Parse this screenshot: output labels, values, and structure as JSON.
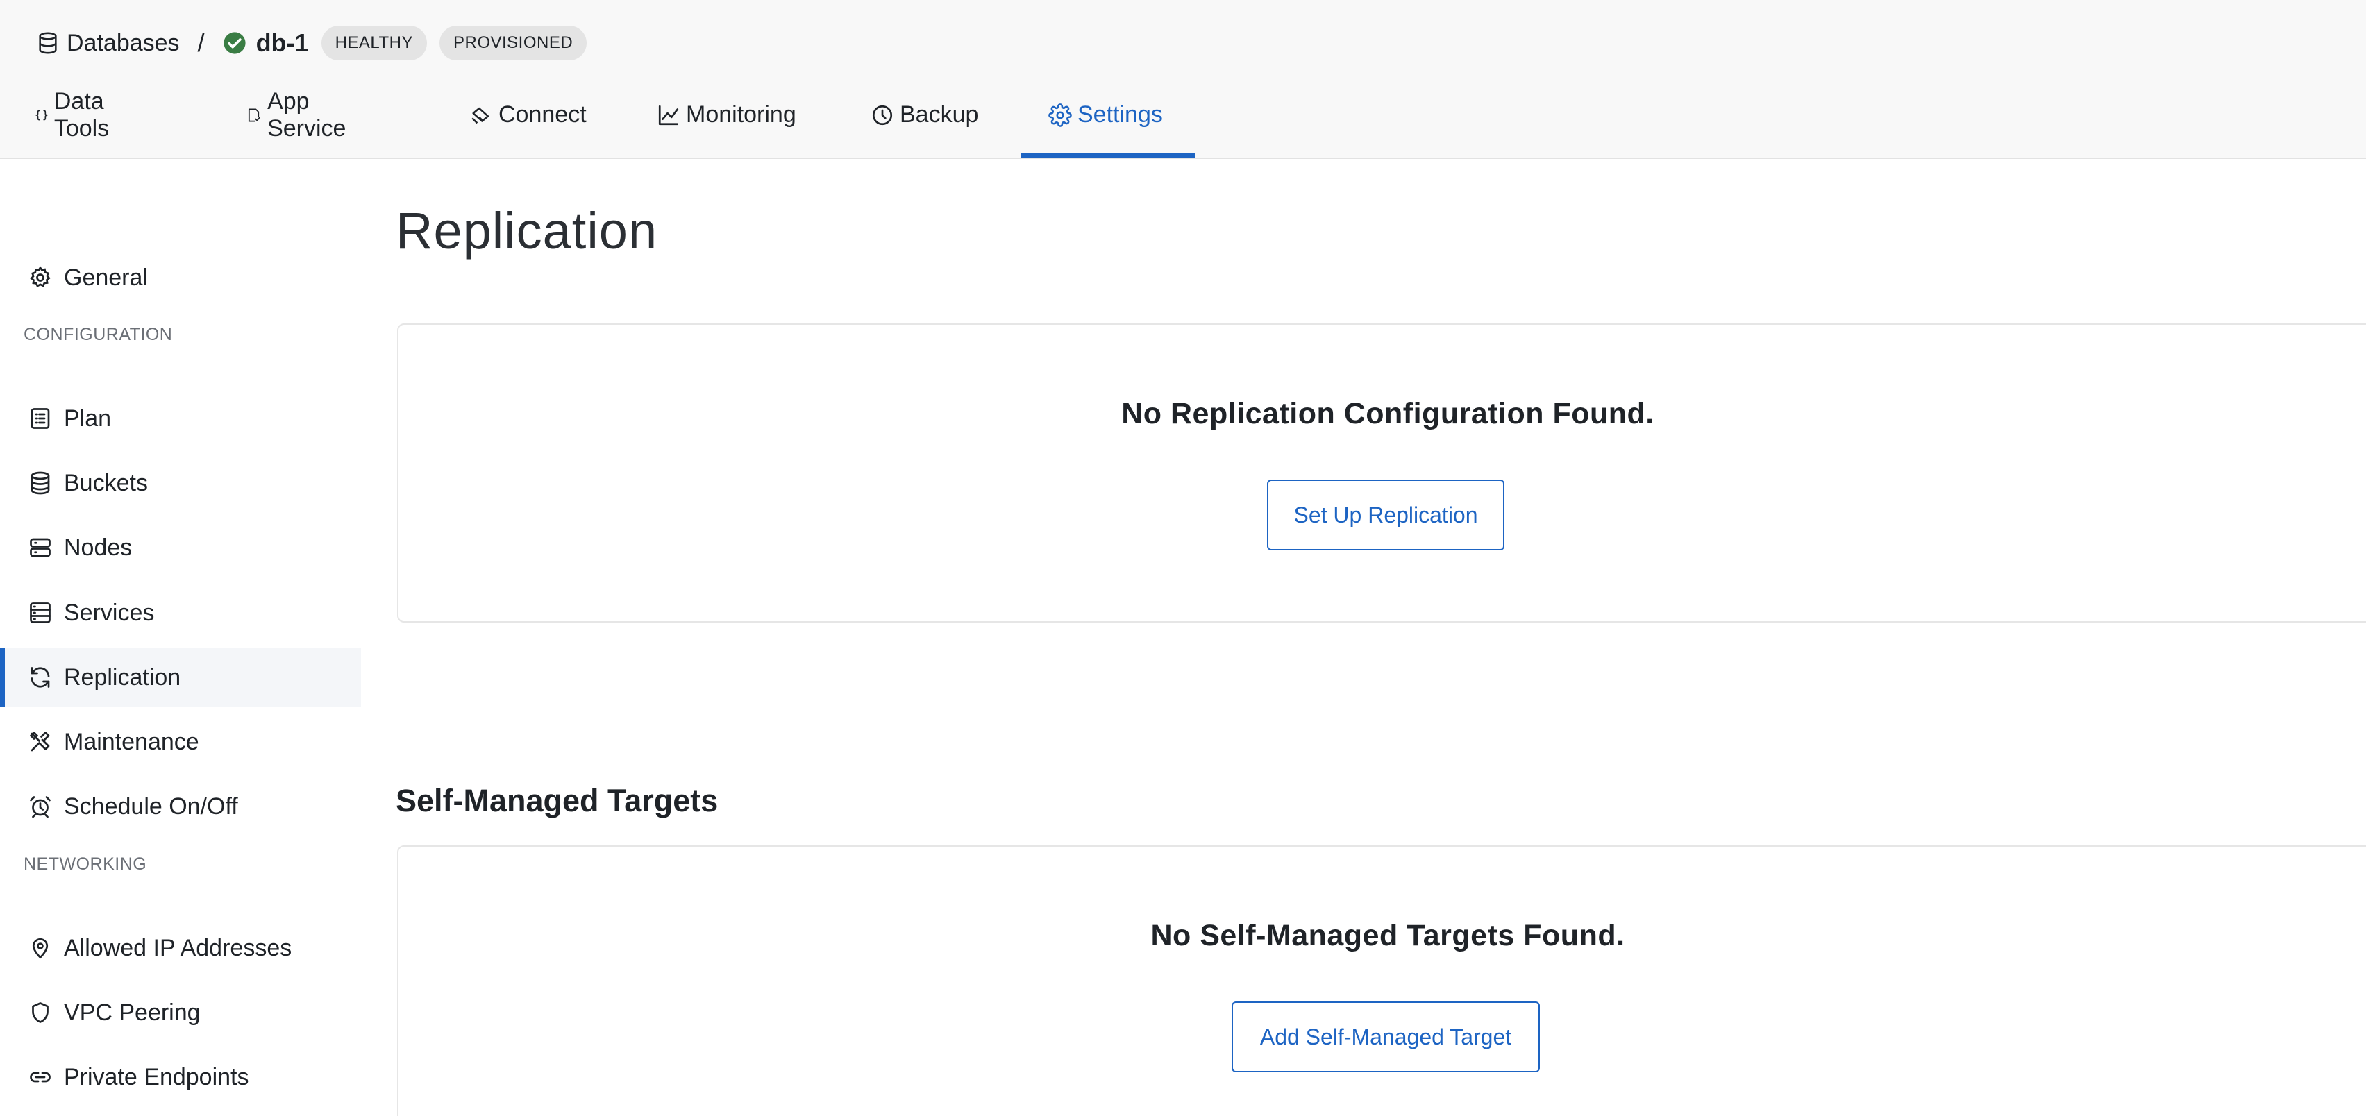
{
  "breadcrumb": {
    "root_label": "Databases",
    "separator": "/",
    "db_name": "db-1",
    "badges": [
      "HEALTHY",
      "PROVISIONED"
    ]
  },
  "tabs": [
    {
      "label": "Data Tools",
      "icon": "braces-icon"
    },
    {
      "label": "App Service",
      "icon": "app-service-icon"
    },
    {
      "label": "Connect",
      "icon": "connect-icon"
    },
    {
      "label": "Monitoring",
      "icon": "chart-line-icon"
    },
    {
      "label": "Backup",
      "icon": "clock-icon"
    },
    {
      "label": "Settings",
      "icon": "gear-icon",
      "active": true
    }
  ],
  "sidebar": {
    "general": {
      "label": "General",
      "icon": "gear-icon"
    },
    "configuration_heading": "CONFIGURATION",
    "configuration_items": [
      {
        "label": "Plan",
        "icon": "plan-icon"
      },
      {
        "label": "Buckets",
        "icon": "database-icon"
      },
      {
        "label": "Nodes",
        "icon": "nodes-icon"
      },
      {
        "label": "Services",
        "icon": "services-icon"
      },
      {
        "label": "Replication",
        "icon": "sync-icon",
        "active": true
      },
      {
        "label": "Maintenance",
        "icon": "tools-icon"
      },
      {
        "label": "Schedule On/Off",
        "icon": "alarm-icon"
      }
    ],
    "networking_heading": "NETWORKING",
    "networking_items": [
      {
        "label": "Allowed IP Addresses",
        "icon": "location-pin-icon"
      },
      {
        "label": "VPC Peering",
        "icon": "shield-icon"
      },
      {
        "label": "Private Endpoints",
        "icon": "link-icon"
      }
    ]
  },
  "main": {
    "title": "Replication",
    "replication_card": {
      "message": "No Replication Configuration Found.",
      "button_label": "Set Up Replication"
    },
    "self_managed": {
      "heading": "Self-Managed Targets",
      "message": "No Self-Managed Targets Found.",
      "button_label": "Add Self-Managed Target"
    }
  },
  "colors": {
    "accent": "#1d64c3",
    "success": "#3a7d44",
    "header_bg": "#f8f8f8",
    "badge_bg": "#e4e4e4"
  }
}
